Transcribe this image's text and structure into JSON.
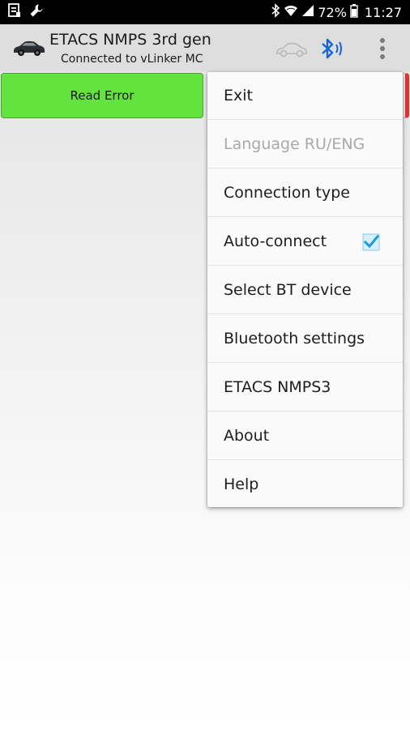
{
  "status_bar": {
    "icons_left": [
      "notification-icon",
      "wrench-icon"
    ],
    "icons_right": [
      "bluetooth-icon",
      "wifi-icon",
      "signal-icon",
      "battery-icon"
    ],
    "battery": "72%",
    "time": "11:27"
  },
  "app_bar": {
    "title": "ETACS NMPS 3rd gen",
    "subtitle": "Connected to vLinker MC",
    "icons": [
      "car-icon",
      "car-outline-icon",
      "bluetooth-connected-icon",
      "more-vert-icon"
    ]
  },
  "buttons": {
    "read_error": "Read Error"
  },
  "menu": {
    "items": [
      {
        "label": "Exit",
        "enabled": true
      },
      {
        "label": "Language RU/ENG",
        "enabled": false
      },
      {
        "label": "Connection type",
        "enabled": true
      },
      {
        "label": "Auto-connect",
        "enabled": true,
        "checked": true
      },
      {
        "label": "Select BT device",
        "enabled": true
      },
      {
        "label": "Bluetooth settings",
        "enabled": true
      },
      {
        "label": "ETACS NMPS3",
        "enabled": true
      },
      {
        "label": "About",
        "enabled": true
      },
      {
        "label": "Help",
        "enabled": true
      }
    ]
  },
  "colors": {
    "read_error_button": "#62e33d",
    "accent_checkbox": "#1e9ad6",
    "bluetooth_blue": "#1565d8",
    "app_bar": "#dedede",
    "status_bar": "#000000"
  }
}
